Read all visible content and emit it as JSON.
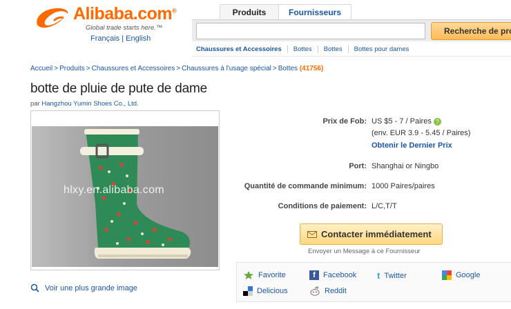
{
  "header": {
    "logo_name": "Alibaba.com",
    "logo_reg": "®",
    "tagline": "Global trade starts here.™",
    "languages": "Français | English",
    "tabs": [
      "Produits",
      "Fournisseurs"
    ],
    "search_placeholder": "",
    "search_button": "Recherche de pro"
  },
  "subcategories": [
    "Chaussures et Accessoires",
    "Bottes",
    "Bottes",
    "Bottes pour dames"
  ],
  "breadcrumb": {
    "items": [
      "Accueil",
      "Produits",
      "Chaussures et Accessoires",
      "Chaussures à l'usage spécial",
      "Bottes"
    ],
    "count": "(41756)"
  },
  "product": {
    "title": "botte de pluie de pute de dame",
    "by_prefix": "par",
    "supplier": "Hangzhou Yumin Shoes Co., Ltd.",
    "watermark": "hlxy.en.alibaba.com",
    "zoom_link": "Voir une plus grande image"
  },
  "details": {
    "fob_label": "Prix de Fob:",
    "fob_value": "US $5 - 7 / Paires",
    "fob_eur": "(env. EUR 3.9 - 5.45 / Paires)",
    "latest_price": "Obtenir le Dernier Prix",
    "port_label": "Port:",
    "port_value": "Shanghai or Ningbo",
    "moq_label": "Quantité de commande minimum:",
    "moq_value": "1000 Paires/paires",
    "payment_label": "Conditions de paiement:",
    "payment_value": "L/C,T/T"
  },
  "contact": {
    "button": "Contacter immédiatement",
    "sub": "Envoyer un Message à ce Fournisseur"
  },
  "share": {
    "favorite": "Favorite",
    "facebook": "Facebook",
    "twitter": "Twitter",
    "google": "Google",
    "delicious": "Delicious",
    "reddit": "Reddit"
  },
  "colors": {
    "brand": "#ff6a00",
    "link": "#1a56a8",
    "boot_green": "#2e8b57"
  }
}
